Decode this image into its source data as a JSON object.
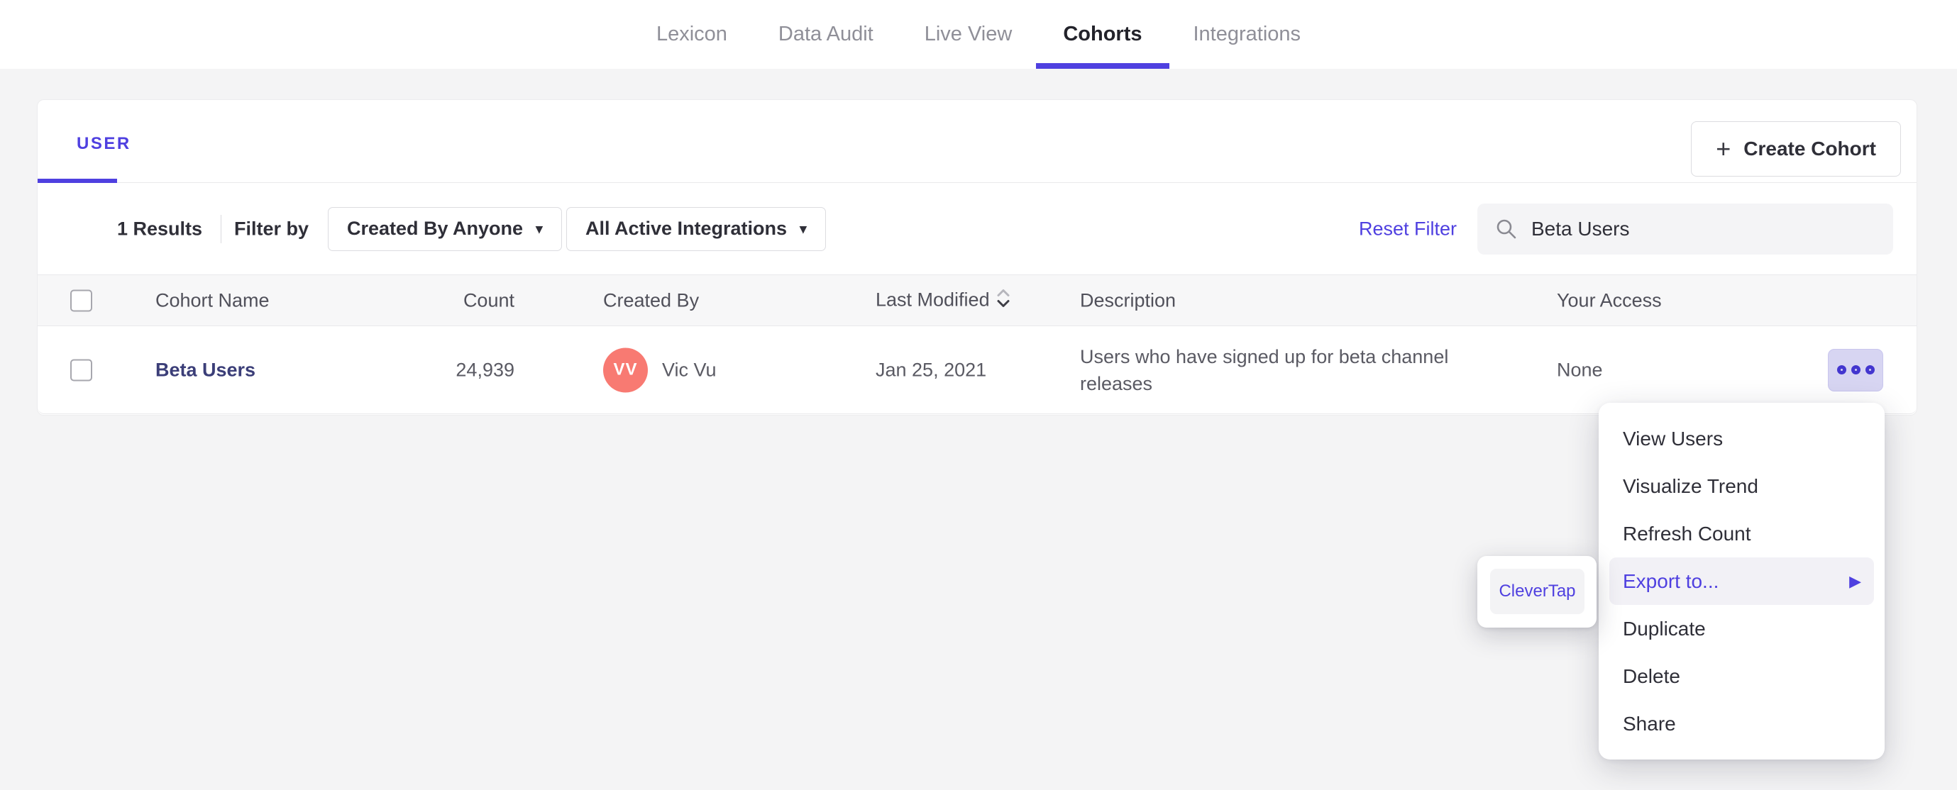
{
  "colors": {
    "accent": "#4f40e0",
    "avatar": "#f87a72",
    "cohort_link": "#3b3e78",
    "menu_highlight_bg": "#f2f1f6",
    "ellipsis_button_bg": "#d7d5f2"
  },
  "nav": {
    "tabs": [
      {
        "label": "Lexicon",
        "active": false
      },
      {
        "label": "Data Audit",
        "active": false
      },
      {
        "label": "Live View",
        "active": false
      },
      {
        "label": "Cohorts",
        "active": true
      },
      {
        "label": "Integrations",
        "active": false
      }
    ]
  },
  "card": {
    "user_tab_label": "USER",
    "create_button_label": "Create Cohort",
    "filter": {
      "results_count": "1 Results",
      "filter_by_label": "Filter by",
      "created_by_dropdown": "Created By Anyone",
      "integrations_dropdown": "All Active Integrations",
      "reset_filter_label": "Reset Filter",
      "search_value": "Beta Users"
    },
    "table": {
      "headers": {
        "name": "Cohort Name",
        "count": "Count",
        "created_by": "Created By",
        "last_modified": "Last Modified",
        "description": "Description",
        "access": "Your Access"
      },
      "row": {
        "name": "Beta Users",
        "count": "24,939",
        "avatar_initials": "VV",
        "created_by": "Vic Vu",
        "last_modified": "Jan 25, 2021",
        "description": "Users who have signed up for beta channel releases",
        "access": "None"
      }
    }
  },
  "menu": {
    "items": [
      {
        "label": "View Users"
      },
      {
        "label": "Visualize Trend"
      },
      {
        "label": "Refresh Count"
      },
      {
        "label": "Export to...",
        "highlighted": true,
        "has_submenu": true
      },
      {
        "label": "Duplicate"
      },
      {
        "label": "Delete"
      },
      {
        "label": "Share"
      }
    ],
    "submenu_option": "CleverTap"
  },
  "icons": {
    "plus": "+",
    "caret_down": "▾",
    "submenu_arrow": "▶"
  }
}
